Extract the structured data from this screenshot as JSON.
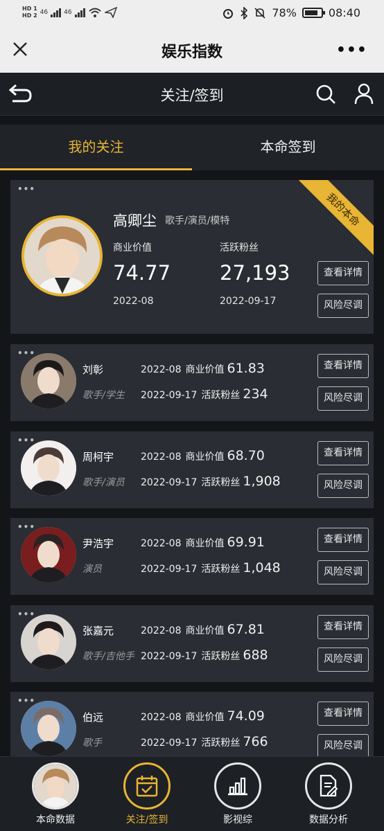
{
  "status": {
    "battery": "78%",
    "time": "08:40",
    "hd1": "HD 1",
    "hd2": "HD 2",
    "net1": "46",
    "net2": "46"
  },
  "window": {
    "title": "娱乐指数",
    "more": "•••"
  },
  "header": {
    "title": "关注/签到"
  },
  "tabs": [
    {
      "label": "我的关注",
      "active": true
    },
    {
      "label": "本命签到",
      "active": false
    }
  ],
  "featured": {
    "name": "高卿尘",
    "tags": "歌手/演员/模特",
    "ribbon": "我的本命",
    "commercial_label": "商业价值",
    "commercial_value": "74.77",
    "commercial_date": "2022-08",
    "fans_label": "活跃粉丝",
    "fans_value": "27,193",
    "fans_date": "2022-09-17",
    "btn_detail": "查看详情",
    "btn_risk": "风险尽调"
  },
  "labels": {
    "commercial": "商业价值",
    "fans": "活跃粉丝",
    "detail": "查看详情",
    "risk": "风险尽调",
    "dots": "•••"
  },
  "list": [
    {
      "name": "刘彰",
      "tags": "歌手/学生",
      "commercial_date": "2022-08",
      "commercial_value": "61.83",
      "fans_date": "2022-09-17",
      "fans_value": "234"
    },
    {
      "name": "周柯宇",
      "tags": "歌手/演员",
      "commercial_date": "2022-08",
      "commercial_value": "68.70",
      "fans_date": "2022-09-17",
      "fans_value": "1,908"
    },
    {
      "name": "尹浩宇",
      "tags": "演员",
      "commercial_date": "2022-08",
      "commercial_value": "69.91",
      "fans_date": "2022-09-17",
      "fans_value": "1,048"
    },
    {
      "name": "张嘉元",
      "tags": "歌手/吉他手",
      "commercial_date": "2022-08",
      "commercial_value": "67.81",
      "fans_date": "2022-09-17",
      "fans_value": "688"
    },
    {
      "name": "伯远",
      "tags": "歌手",
      "commercial_date": "2022-08",
      "commercial_value": "74.09",
      "fans_date": "2022-09-17",
      "fans_value": "766"
    }
  ],
  "bottom_nav": [
    {
      "label": "本命数据",
      "icon": "avatar",
      "active": false
    },
    {
      "label": "关注/签到",
      "icon": "calendar-check-icon",
      "active": true
    },
    {
      "label": "影视综",
      "icon": "bar-chart-icon",
      "active": false
    },
    {
      "label": "数据分析",
      "icon": "document-edit-icon",
      "active": false
    }
  ],
  "colors": {
    "accent": "#e8b534",
    "card": "#2a2d33",
    "background": "#141518"
  }
}
